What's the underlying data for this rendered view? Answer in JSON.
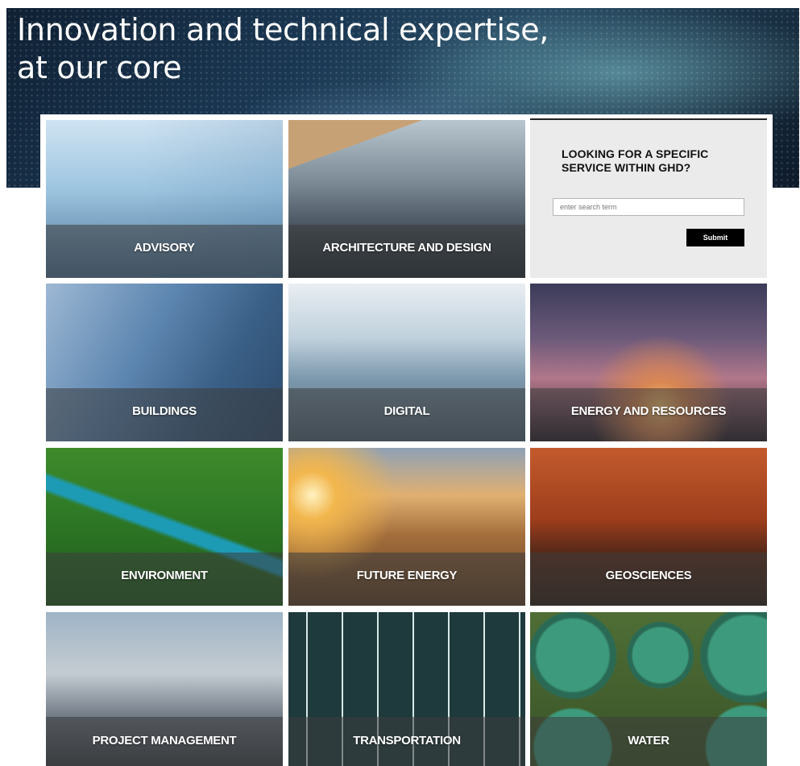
{
  "hero": {
    "title_line1": "Innovation and technical expertise,",
    "title_line2": "at our core"
  },
  "search": {
    "heading": "LOOKING FOR A SPECIFIC SERVICE WITHIN GHD?",
    "placeholder": "enter search term",
    "submit_label": "Submit"
  },
  "services": [
    {
      "label": "ADVISORY",
      "image": "advisory-image"
    },
    {
      "label": "ARCHITECTURE AND DESIGN",
      "image": "architecture-image"
    },
    {
      "label": "BUILDINGS",
      "image": "buildings-image"
    },
    {
      "label": "DIGITAL",
      "image": "digital-image"
    },
    {
      "label": "ENERGY AND RESOURCES",
      "image": "energy-image"
    },
    {
      "label": "ENVIRONMENT",
      "image": "environment-image"
    },
    {
      "label": "FUTURE ENERGY",
      "image": "future-energy-image"
    },
    {
      "label": "GEOSCIENCES",
      "image": "geosciences-image"
    },
    {
      "label": "PROJECT MANAGEMENT",
      "image": "project-management-image"
    },
    {
      "label": "TRANSPORTATION",
      "image": "transportation-image"
    },
    {
      "label": "WATER",
      "image": "water-image"
    }
  ],
  "colors": {
    "overlay": "#3c3c3c",
    "panel_bg": "#ebebeb",
    "button_bg": "#000000"
  }
}
